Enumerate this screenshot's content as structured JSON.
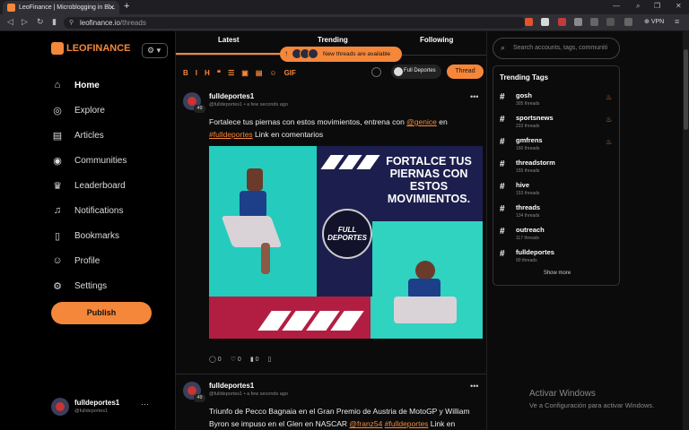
{
  "browser": {
    "tab_title": "LeoFinance | Microblogging in Bl...",
    "url_domain": "leofinance.io",
    "url_path": "/threads",
    "vpn_label": "VPN"
  },
  "sidebar": {
    "logo_text": "LEOFINANCE",
    "items": [
      {
        "label": "Home",
        "icon": "home-icon"
      },
      {
        "label": "Explore",
        "icon": "compass-icon"
      },
      {
        "label": "Articles",
        "icon": "articles-icon"
      },
      {
        "label": "Communities",
        "icon": "globe-icon"
      },
      {
        "label": "Leaderboard",
        "icon": "trophy-icon"
      },
      {
        "label": "Notifications",
        "icon": "bell-icon"
      },
      {
        "label": "Bookmarks",
        "icon": "bookmark-icon"
      },
      {
        "label": "Profile",
        "icon": "user-icon"
      },
      {
        "label": "Settings",
        "icon": "gear-icon"
      }
    ],
    "publish_label": "Publish",
    "user": {
      "name": "fulldeportes1",
      "handle": "@fulldeportes1",
      "more": "···"
    }
  },
  "feed": {
    "tabs": [
      "Latest",
      "Trending",
      "Following"
    ],
    "active_tab": "Latest",
    "new_threads_label": "New threads are available",
    "toolbar": [
      "B",
      "I",
      "H",
      "❝",
      "☰",
      "▣",
      "▤",
      "☺",
      "GIF"
    ],
    "community_label": "Full Deportes",
    "thread_button_label": "Thread",
    "posts": [
      {
        "author": "fulldeportes1",
        "handle": "@fulldeportes1",
        "time": "a few seconds ago",
        "badge": "49",
        "text_before": "Fortalece tus piernas con estos movimientos, entrena con ",
        "mention": "@genice",
        "text_mid": " en ",
        "hashtag": "#fulldeportes",
        "text_after": " Link en comentarios",
        "image_title": "FORTALCE TUS PIERNAS CON ESTOS MOVIMIENTOS.",
        "image_logo": "FULL DEPORTES",
        "stats": {
          "comments": "0",
          "likes": "0",
          "votes": "0"
        }
      },
      {
        "author": "fulldeportes1",
        "handle": "@fulldeportes1",
        "time": "a few seconds ago",
        "badge": "49",
        "text_before": "Triunfo de Pecco Bagnaia en el Gran Premio de Austria de MotoGP y William Byron se impuso en el Glen en NASCAR ",
        "mention": "@franz54",
        "text_mid": " ",
        "hashtag": "#fulldeportes",
        "text_after": " Link en"
      }
    ]
  },
  "right": {
    "search_placeholder": "Search accounts, tags, communiti",
    "trending_title": "Trending Tags",
    "tags": [
      {
        "name": "gosh",
        "count": "305 threads",
        "hot": true
      },
      {
        "name": "sportsnews",
        "count": "233 threads",
        "hot": true
      },
      {
        "name": "gmfrens",
        "count": "160 threads",
        "hot": true
      },
      {
        "name": "threadstorm",
        "count": "155 threads",
        "hot": false
      },
      {
        "name": "hive",
        "count": "153 threads",
        "hot": false
      },
      {
        "name": "threads",
        "count": "134 threads",
        "hot": false
      },
      {
        "name": "outreach",
        "count": "117 threads",
        "hot": false
      },
      {
        "name": "fulldeportes",
        "count": "90 threads",
        "hot": false
      }
    ],
    "show_more": "Show more"
  },
  "os": {
    "activate_title": "Activar Windows",
    "activate_sub": "Ve a Configuración para activar Windows."
  },
  "colors": {
    "accent": "#f5873a",
    "background": "#0b0b0b"
  }
}
